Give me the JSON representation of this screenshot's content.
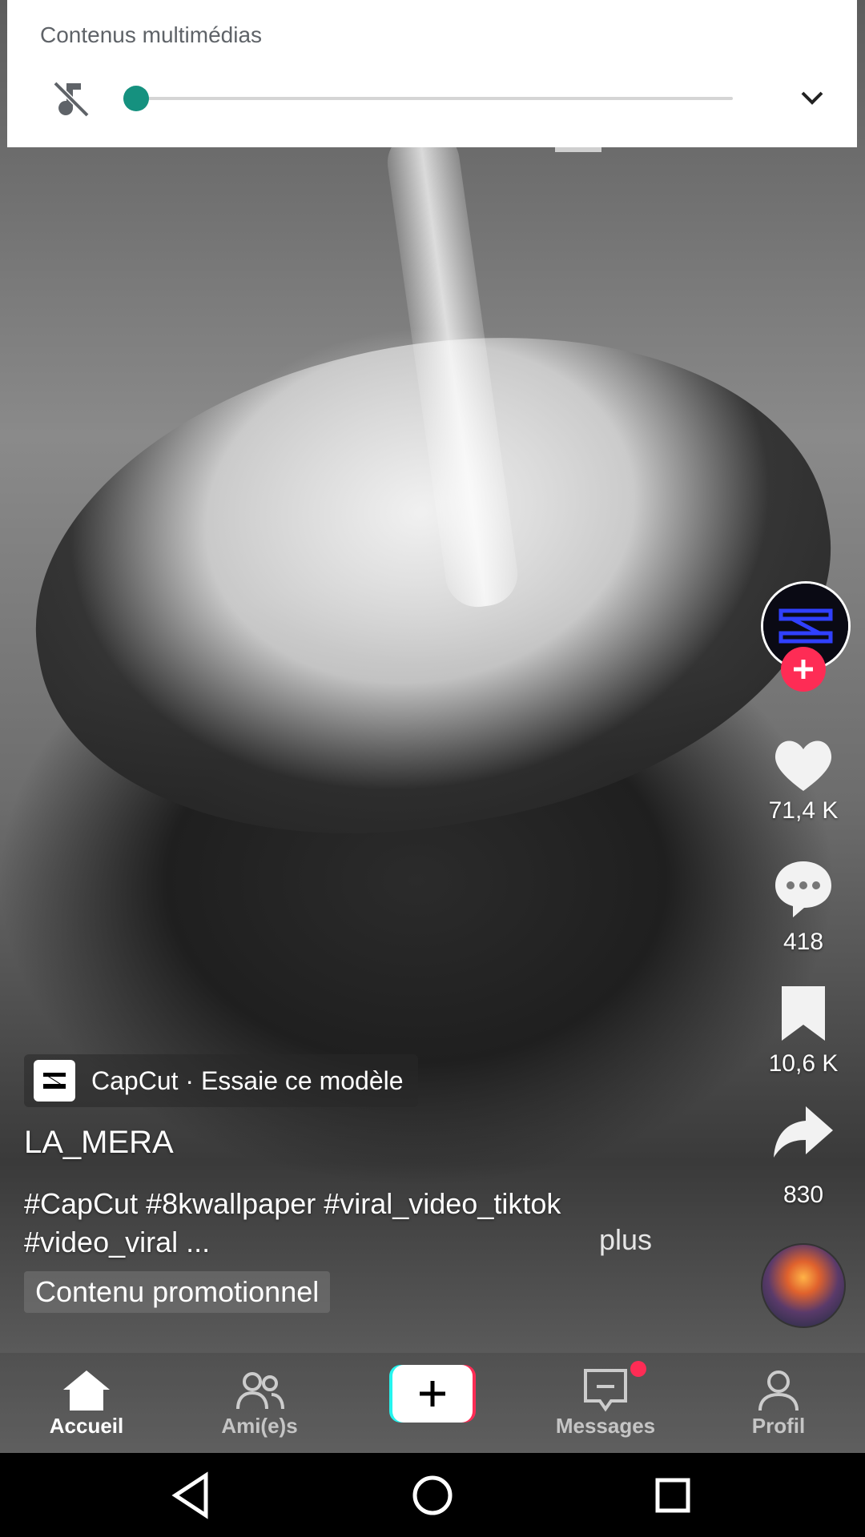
{
  "media_panel": {
    "title": "Contenus multimédias",
    "volume_level": 0.0,
    "icons": {
      "mute": "music-off-icon",
      "expand": "chevron-down-icon"
    }
  },
  "video": {
    "description_visual": "",
    "creator": {
      "username": "LA_MERA",
      "template_chip": "CapCut · Essaie ce modèle",
      "caption_line1": "#CapCut #8kwallpaper #viral_video_tiktok",
      "caption_line2": "#video_viral ...",
      "more_label": "plus",
      "promo_label": "Contenu promotionnel"
    }
  },
  "rail": {
    "likes": "71,4 K",
    "comments": "418",
    "saves": "10,6 K",
    "shares": "830"
  },
  "nav": {
    "home": "Accueil",
    "friends": "Ami(e)s",
    "messages": "Messages",
    "profile": "Profil"
  },
  "colors": {
    "accent": "#fe2c55",
    "slider": "#15917f",
    "create_cyan": "#25f4ee",
    "create_red": "#fe2c55"
  }
}
